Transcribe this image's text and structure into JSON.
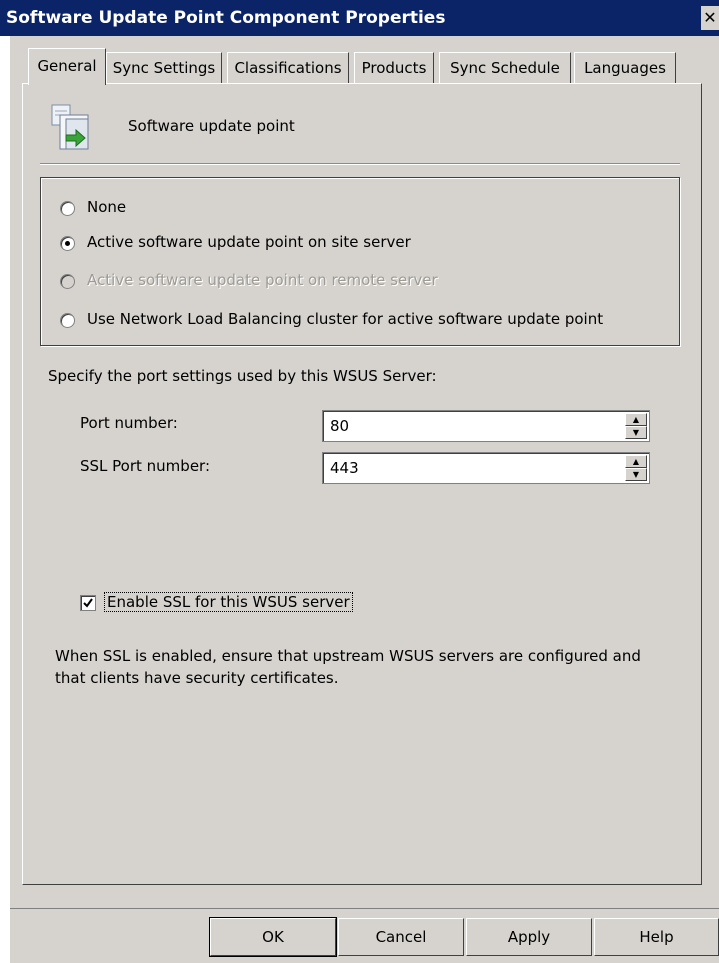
{
  "window": {
    "title": "Software Update Point Component Properties",
    "close_glyph": "✕"
  },
  "tabs": [
    {
      "label": "General",
      "active": true
    },
    {
      "label": "Sync Settings",
      "active": false
    },
    {
      "label": "Classifications",
      "active": false
    },
    {
      "label": "Products",
      "active": false
    },
    {
      "label": "Sync Schedule",
      "active": false
    },
    {
      "label": "Languages",
      "active": false
    }
  ],
  "header": {
    "icon": "software-update-point-icon",
    "text": "Software update point"
  },
  "options": [
    {
      "label": "None",
      "checked": false,
      "enabled": true
    },
    {
      "label": "Active software update point on site server",
      "checked": true,
      "enabled": true
    },
    {
      "label": "Active software update point on remote server",
      "checked": false,
      "enabled": false
    },
    {
      "label": "Use Network Load Balancing cluster for active software update point",
      "checked": false,
      "enabled": true
    }
  ],
  "ports": {
    "caption": "Specify the port settings used by this WSUS Server:",
    "port_label": "Port number:",
    "port_value": "80",
    "ssl_port_label": "SSL Port number:",
    "ssl_port_value": "443"
  },
  "ssl": {
    "label": "Enable SSL for this WSUS server",
    "checked": true
  },
  "note": "When SSL is enabled, ensure that upstream WSUS servers are configured and that clients have security certificates.",
  "buttons": {
    "ok": "OK",
    "cancel": "Cancel",
    "apply": "Apply",
    "help": "Help"
  }
}
